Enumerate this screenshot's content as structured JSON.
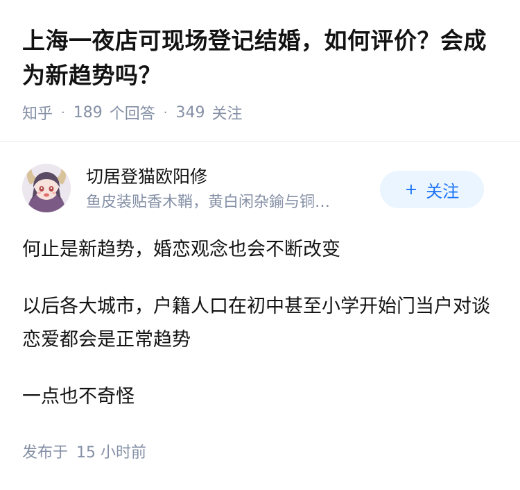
{
  "question": {
    "title": "上海一夜店可现场登记结婚，如何评价？会成为新趋势吗？",
    "source": "知乎",
    "answer_count": "189",
    "answer_label": "个回答",
    "follow_count": "349",
    "follow_label": "关注"
  },
  "author": {
    "name": "切居登猫欧阳修",
    "bio": "鱼皮装贴香木鞘，黄白闲杂鍮与铜…",
    "follow_button": "关注",
    "follow_icon": "plus-icon"
  },
  "answer": {
    "paragraphs": [
      "何止是新趋势，婚恋观念也会不断改变",
      "以后各大城市，户籍人口在初中甚至小学开始门当户对谈恋爱都会是正常趋势",
      "一点也不奇怪"
    ]
  },
  "footer": {
    "published_label": "发布于",
    "published_value": "15 小时前"
  },
  "colors": {
    "text_primary": "#121212",
    "text_secondary": "#8590a6",
    "accent": "#1772f6",
    "accent_bg": "#ebf5ff"
  }
}
